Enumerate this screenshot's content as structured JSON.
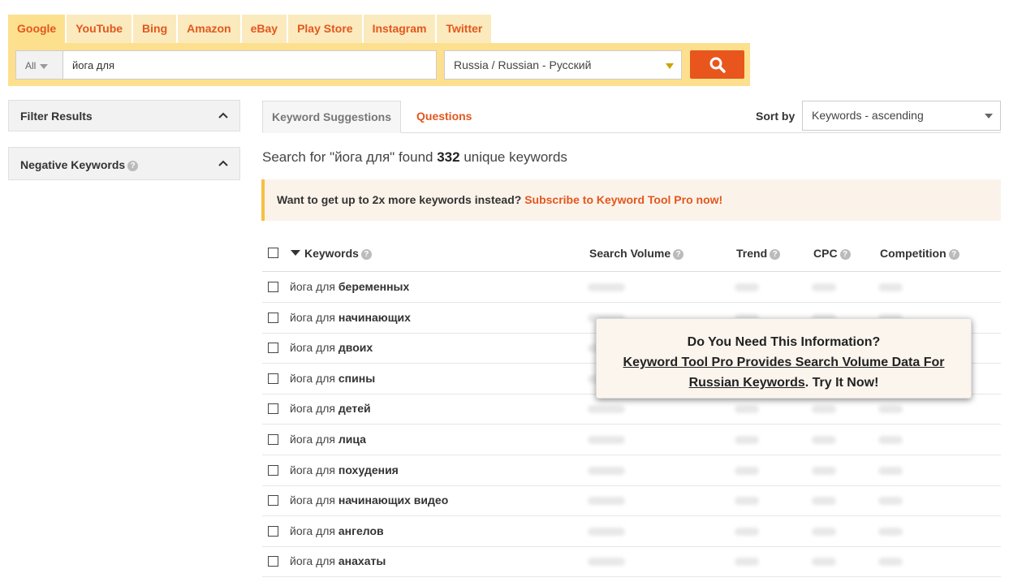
{
  "tabs": [
    "Google",
    "YouTube",
    "Bing",
    "Amazon",
    "eBay",
    "Play Store",
    "Instagram",
    "Twitter"
  ],
  "search": {
    "scope": "All",
    "query": "йога для",
    "language": "Russia / Russian - Русский"
  },
  "sidebar": {
    "filter_label": "Filter Results",
    "negative_label": "Negative Keywords"
  },
  "main": {
    "tab_suggestions": "Keyword Suggestions",
    "tab_questions": "Questions",
    "sort_label": "Sort by",
    "sort_value": "Keywords - ascending",
    "summary_prefix": "Search for \"йога для\" found",
    "summary_count": "332",
    "summary_suffix": "unique keywords",
    "promo_text": "Want to get up to 2x more keywords instead?",
    "promo_link": "Subscribe to Keyword Tool Pro now!"
  },
  "table": {
    "columns": [
      "Keywords",
      "Search Volume",
      "Trend",
      "CPC",
      "Competition"
    ],
    "rows": [
      {
        "prefix": "йога для",
        "bold": "беременных"
      },
      {
        "prefix": "йога для",
        "bold": "начинающих"
      },
      {
        "prefix": "йога для",
        "bold": "двоих"
      },
      {
        "prefix": "йога для",
        "bold": "спины"
      },
      {
        "prefix": "йога для",
        "bold": "детей"
      },
      {
        "prefix": "йога для",
        "bold": "лица"
      },
      {
        "prefix": "йога для",
        "bold": "похудения"
      },
      {
        "prefix": "йога для",
        "bold": "начинающих видео"
      },
      {
        "prefix": "йога для",
        "bold": "ангелов"
      },
      {
        "prefix": "йога для",
        "bold": "анахаты"
      }
    ]
  },
  "overlay": {
    "line1": "Do You Need This Information?",
    "link": "Keyword Tool Pro Provides Search Volume Data For Russian Keywords",
    "after": ". Try It Now!"
  },
  "colors": {
    "accent": "#e2571e",
    "tab_bg": "#fbeabd",
    "search_bg": "#fde08e"
  }
}
